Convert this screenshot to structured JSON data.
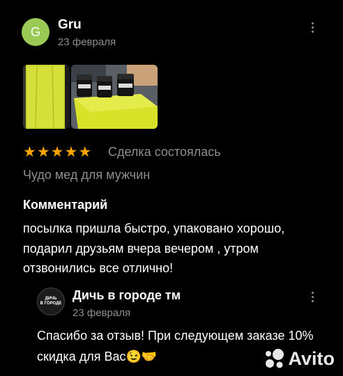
{
  "review": {
    "avatar_letter": "G",
    "author": "Gru",
    "date": "23 февраля",
    "rating": 5,
    "deal_status": "Сделка состоялась",
    "product": "Чудо мед для мужчин",
    "comment_title": "Комментарий",
    "comment_text": "посылка пришла быстро, упаковано хорошо, подарил друзьям вчера вечером , утром отзвонились все отлично!"
  },
  "seller_reply": {
    "avatar_text_top": "ДИЧЬ",
    "avatar_text_bottom": "В ГОРОДЕ",
    "name": "Дичь в городе тм",
    "date": "23 февраля",
    "text": "Спасибо за отзыв! При следующем заказе 10% скидка для Вас",
    "emoji": "😉🤝"
  },
  "brand": {
    "logo_text": "Avito"
  },
  "icons": {
    "more": "kebab-icon",
    "star": "star-icon"
  },
  "colors": {
    "avatar_bg": "#9bc955",
    "star": "#fca400",
    "secondary_text": "#8e8e8e"
  }
}
